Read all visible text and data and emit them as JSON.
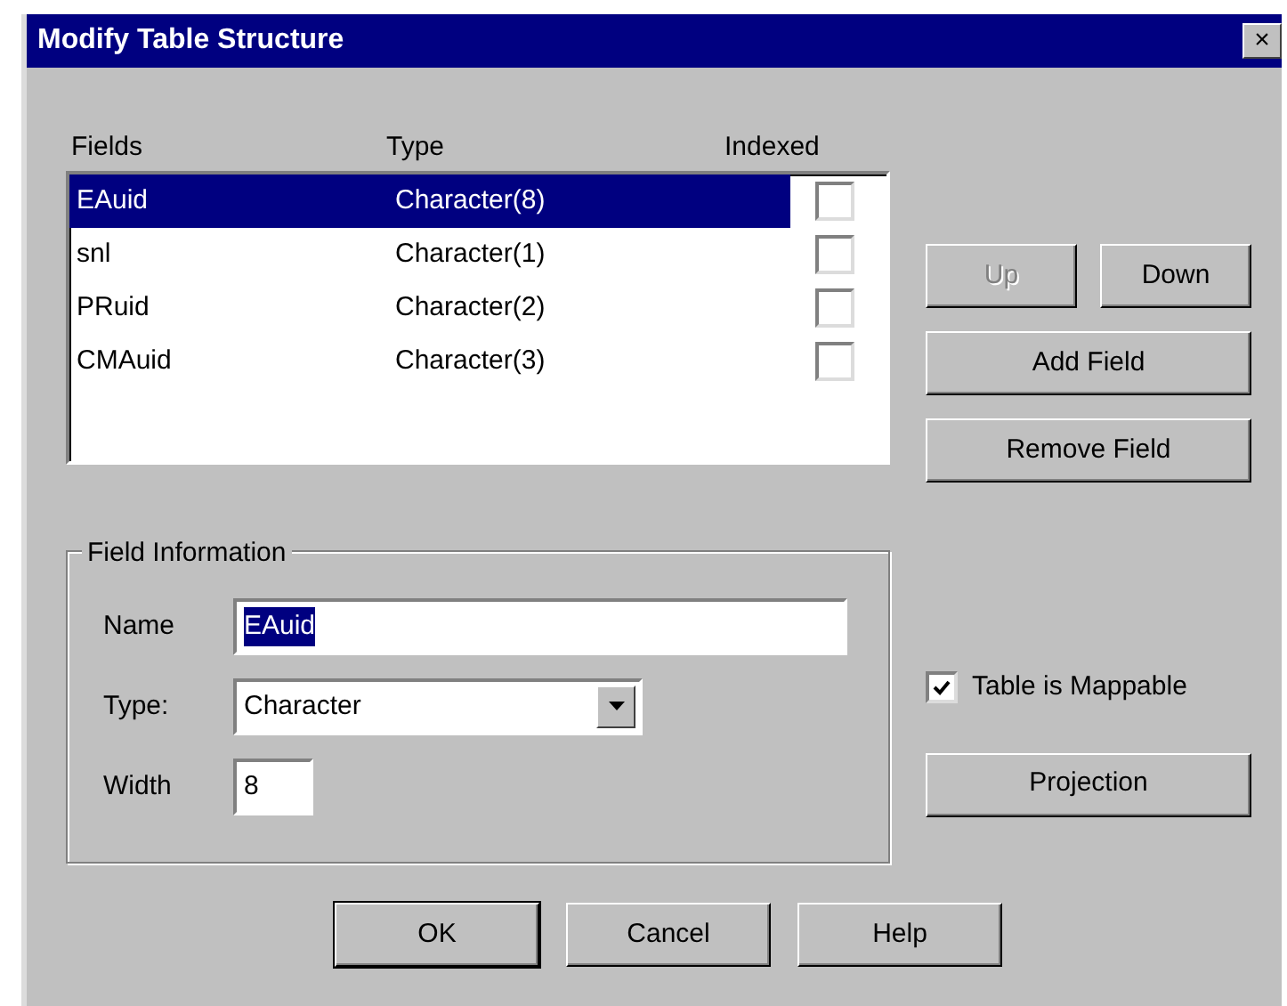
{
  "window": {
    "title": "Modify Table Structure",
    "close": "×"
  },
  "field_list": {
    "columns": [
      "Fields",
      "Type",
      "Indexed"
    ],
    "rows": [
      {
        "name": "EAuid",
        "type": "Character(8)",
        "indexed": false,
        "selected": true
      },
      {
        "name": "snl",
        "type": "Character(1)",
        "indexed": false,
        "selected": false
      },
      {
        "name": "PRuid",
        "type": "Character(2)",
        "indexed": false,
        "selected": false
      },
      {
        "name": "CMAuid",
        "type": "Character(3)",
        "indexed": false,
        "selected": false
      }
    ]
  },
  "list_buttons": [
    {
      "label": "Up",
      "disabled": true
    },
    {
      "label": "Down",
      "disabled": false
    },
    {
      "label": "Add Field",
      "disabled": false
    },
    {
      "label": "Remove Field",
      "disabled": false
    }
  ],
  "field_information": {
    "title": "Field Information",
    "name_label": "Name",
    "name_value": "EAuid",
    "type_label": "Type:",
    "type_value": "Character",
    "width_label": "Width",
    "width_value": "8"
  },
  "mappable": {
    "label": "Table is Mappable",
    "checked": true
  },
  "projection_button": "Projection",
  "footer_buttons": [
    {
      "label": "OK",
      "default": true
    },
    {
      "label": "Cancel",
      "default": false
    },
    {
      "label": "Help",
      "default": false
    }
  ]
}
